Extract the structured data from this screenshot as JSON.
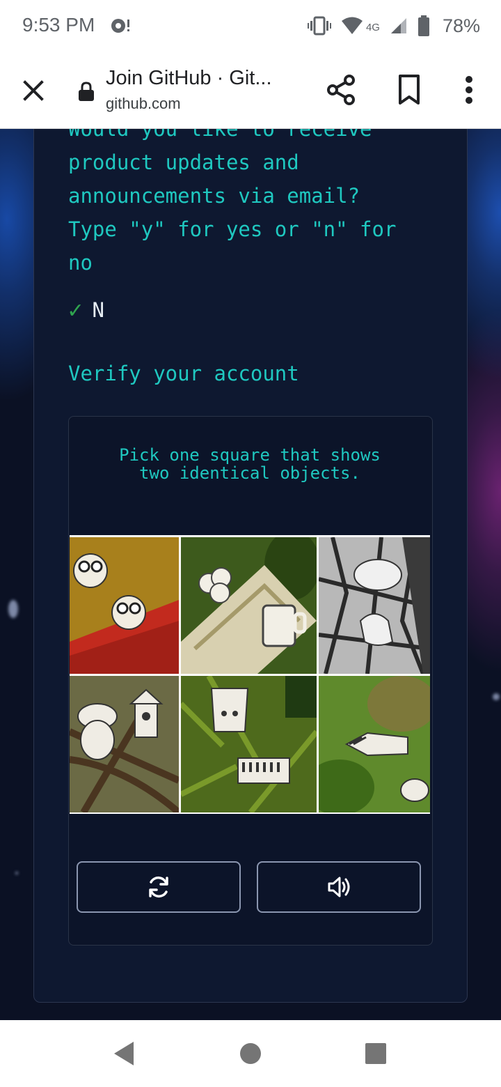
{
  "status_bar": {
    "time": "9:53 PM",
    "network": "4G",
    "battery": "78%",
    "icons": [
      "notification-icon",
      "vibrate-icon",
      "wifi-icon",
      "signal-icon",
      "battery-icon"
    ]
  },
  "toolbar": {
    "title": "Join GitHub · Git...",
    "url": "github.com",
    "icons": [
      "close-icon",
      "lock-icon",
      "share-icon",
      "bookmark-icon",
      "more-vert-icon"
    ]
  },
  "form": {
    "prompt_lines": [
      "Would you like to receive",
      "product updates and",
      "announcements via email?",
      "Type \"y\" for yes or \"n\" for",
      "no"
    ],
    "answer": "N",
    "answer_icon": "checkmark-icon",
    "verify_heading": "Verify your account"
  },
  "captcha": {
    "instruction": "Pick one square that shows two identical objects.",
    "tiles": [
      {
        "id": "tile-1",
        "content": "two identical owls"
      },
      {
        "id": "tile-2",
        "content": "clover and mug"
      },
      {
        "id": "tile-3",
        "content": "cloud and hand"
      },
      {
        "id": "tile-4",
        "content": "acorn and birdhouse"
      },
      {
        "id": "tile-5",
        "content": "robot and piano"
      },
      {
        "id": "tile-6",
        "content": "arrow and turtle"
      }
    ],
    "buttons": [
      "refresh-icon",
      "audio-icon"
    ]
  },
  "colors": {
    "accent_text": "#1fc8c0",
    "page_background": "#0b1124",
    "card_background": "#0e1830",
    "check": "#2fa44f"
  },
  "nav_bar": {
    "icons": [
      "back-icon",
      "home-icon",
      "recents-icon"
    ]
  }
}
